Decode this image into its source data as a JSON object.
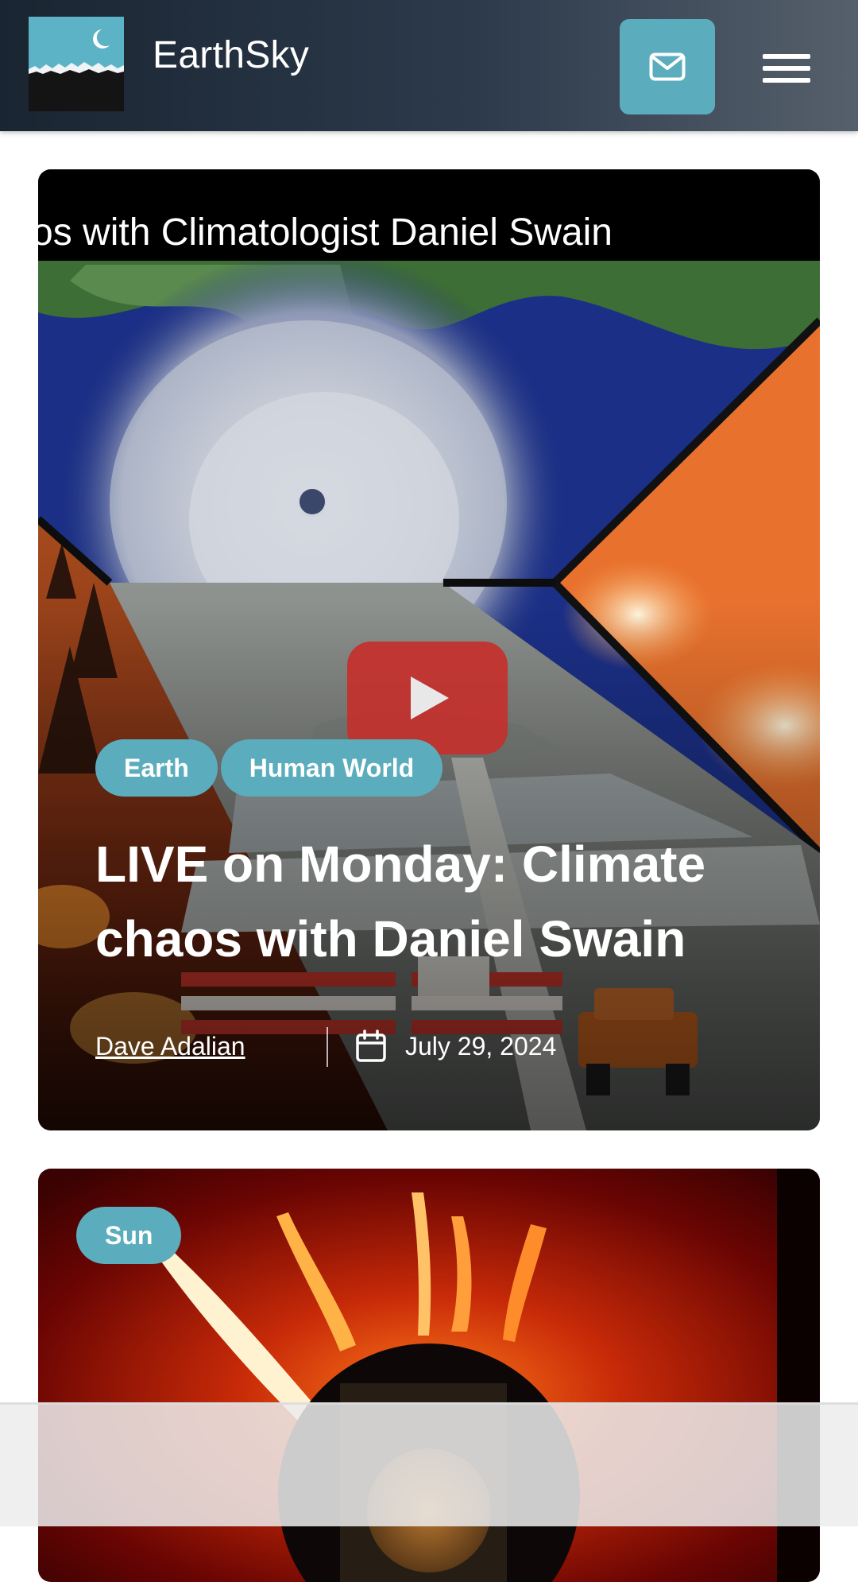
{
  "header": {
    "site_name": "EarthSky",
    "logo_icon": "earthsky-moon-mountain-logo",
    "subscribe_icon": "mail-icon",
    "menu_icon": "hamburger-menu-icon",
    "accent_color": "#5badbd"
  },
  "featured_post": {
    "video_caption": "os with Climatologist Daniel Swain",
    "video_play_icon": "youtube-play-icon",
    "categories": [
      "Earth",
      "Human World"
    ],
    "title": "LIVE on Monday: Climate chaos with Daniel Swain",
    "author": "Dave Adalian",
    "date_icon": "calendar-icon",
    "date": "July 29, 2024"
  },
  "second_post": {
    "categories": [
      "Sun"
    ]
  }
}
